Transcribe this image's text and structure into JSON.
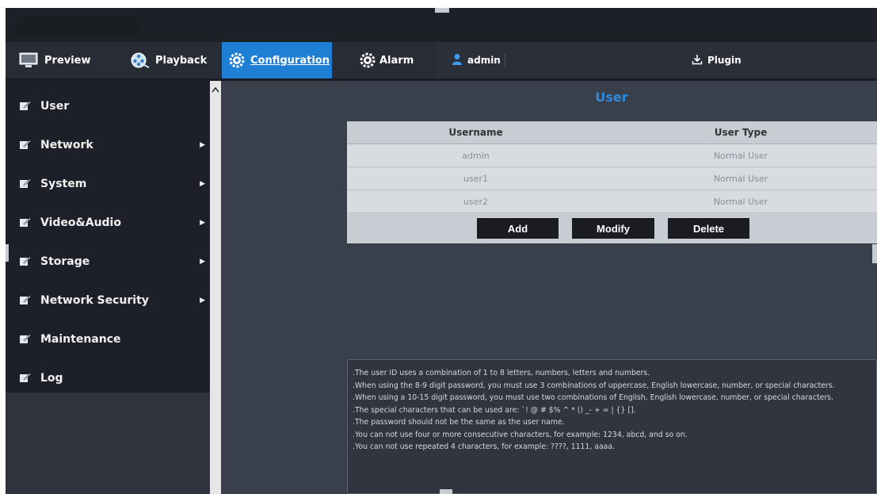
{
  "nav": {
    "preview_label": "Preview",
    "playback_label": "Playback",
    "configuration_label": "Configuration",
    "alarm_label": "Alarm",
    "user_label": "admin",
    "plugin_label": "Plugin"
  },
  "sidebar": {
    "items": [
      {
        "label": "User",
        "has_submenu": false
      },
      {
        "label": "Network",
        "has_submenu": true
      },
      {
        "label": "System",
        "has_submenu": true
      },
      {
        "label": "Video&Audio",
        "has_submenu": true
      },
      {
        "label": "Storage",
        "has_submenu": true
      },
      {
        "label": "Network Security",
        "has_submenu": true
      },
      {
        "label": "Maintenance",
        "has_submenu": false
      },
      {
        "label": "Log",
        "has_submenu": false
      }
    ]
  },
  "main": {
    "title": "User",
    "table": {
      "headers": [
        "Username",
        "User Type"
      ],
      "rows": [
        [
          "admin",
          "Normal User"
        ],
        [
          "user1",
          "Normal User"
        ],
        [
          "user2",
          "Normal User"
        ]
      ]
    },
    "buttons": {
      "add": "Add",
      "modify": "Modify",
      "delete": "Delete"
    },
    "notes": [
      ".The user ID uses a combination of 1 to 8 letters, numbers, letters and numbers.",
      ".When using the 8-9 digit password, you must use 3 combinations of uppercase, English lowercase, number, or special characters.",
      ".When using a 10-15 digit password, you must use two combinations of English, English lowercase, number, or special characters.",
      ".The special characters that can be used are: `! @ # $% ^ * () _- + = | {} [].",
      ".The password should not be the same as the user name.",
      ".You can not use four or more consecutive characters, for example: 1234, abcd, and so on.",
      ".You can not use repeated 4 characters, for example: ????, 1111, aaaa."
    ]
  },
  "colors": {
    "accent": "#1f7fd4",
    "title": "#2e8bdc",
    "sidebar_bg": "#1d2028",
    "content_bg": "#3a3f4c"
  }
}
